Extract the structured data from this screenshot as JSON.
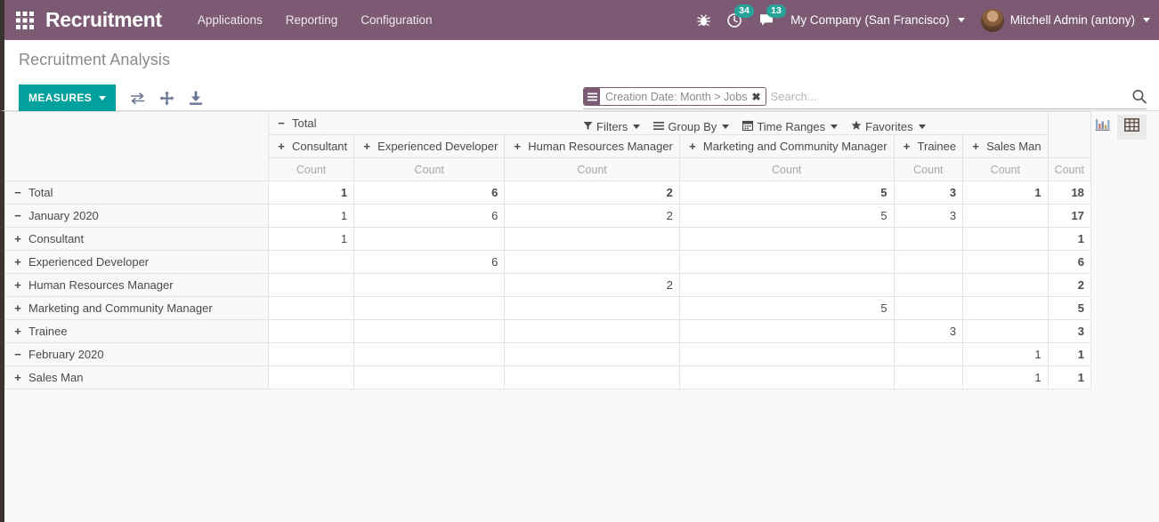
{
  "navbar": {
    "apps_icon": "apps-grid-icon",
    "brand": "Recruitment",
    "menu": [
      {
        "label": "Applications"
      },
      {
        "label": "Reporting"
      },
      {
        "label": "Configuration"
      }
    ],
    "bug_icon": "bug-icon",
    "activity_icon": "clock-activity-icon",
    "activity_count": "34",
    "messages_icon": "chat-messages-icon",
    "messages_count": "13",
    "company": "My Company (San Francisco)",
    "user": "Mitchell Admin (antony)",
    "brand_color": "#7c5a73",
    "badge_color": "#27a39a"
  },
  "control_panel": {
    "title": "Recruitment Analysis",
    "measures_label": "MEASURES",
    "measures_color": "#00a09d",
    "tools": [
      {
        "name": "flip-axis-icon"
      },
      {
        "name": "expand-all-icon"
      },
      {
        "name": "download-xlsx-icon"
      }
    ],
    "search": {
      "facet_label": "Creation Date: Month > Jobs",
      "facet_remove": "✖",
      "placeholder": "Search...",
      "value": ""
    },
    "filters": [
      {
        "label": "Filters",
        "icon": "filter-icon"
      },
      {
        "label": "Group By",
        "icon": "group-by-icon"
      },
      {
        "label": "Time Ranges",
        "icon": "calendar-icon"
      },
      {
        "label": "Favorites",
        "icon": "star-icon"
      }
    ],
    "views": [
      {
        "name": "graph-view",
        "icon": "bar-chart-icon",
        "active": false
      },
      {
        "name": "pivot-view",
        "icon": "pivot-table-icon",
        "active": true
      }
    ]
  },
  "pivot": {
    "col_root": {
      "label": "Total",
      "toggle": "−"
    },
    "columns": [
      {
        "label": "Consultant",
        "toggle": "+"
      },
      {
        "label": "Experienced Developer",
        "toggle": "+"
      },
      {
        "label": "Human Resources Manager",
        "toggle": "+"
      },
      {
        "label": "Marketing and Community Manager",
        "toggle": "+"
      },
      {
        "label": "Trainee",
        "toggle": "+"
      },
      {
        "label": "Sales Man",
        "toggle": "+"
      }
    ],
    "measure_label": "Count",
    "total_measure_label": "Count",
    "rows": [
      {
        "label": "Total",
        "toggle": "−",
        "indent": 0,
        "bold": true,
        "values": [
          "1",
          "6",
          "2",
          "5",
          "3",
          "1"
        ],
        "total": "18"
      },
      {
        "label": "January 2020",
        "toggle": "−",
        "indent": 1,
        "bold": false,
        "values": [
          "1",
          "6",
          "2",
          "5",
          "3",
          ""
        ],
        "total": "17"
      },
      {
        "label": "Consultant",
        "toggle": "+",
        "indent": 2,
        "bold": false,
        "values": [
          "1",
          "",
          "",
          "",
          "",
          ""
        ],
        "total": "1"
      },
      {
        "label": "Experienced Developer",
        "toggle": "+",
        "indent": 2,
        "bold": false,
        "values": [
          "",
          "6",
          "",
          "",
          "",
          ""
        ],
        "total": "6"
      },
      {
        "label": "Human Resources Manager",
        "toggle": "+",
        "indent": 2,
        "bold": false,
        "values": [
          "",
          "",
          "2",
          "",
          "",
          ""
        ],
        "total": "2"
      },
      {
        "label": "Marketing and Community Manager",
        "toggle": "+",
        "indent": 2,
        "bold": false,
        "values": [
          "",
          "",
          "",
          "5",
          "",
          ""
        ],
        "total": "5"
      },
      {
        "label": "Trainee",
        "toggle": "+",
        "indent": 2,
        "bold": false,
        "values": [
          "",
          "",
          "",
          "",
          "3",
          ""
        ],
        "total": "3"
      },
      {
        "label": "February 2020",
        "toggle": "−",
        "indent": 1,
        "bold": false,
        "values": [
          "",
          "",
          "",
          "",
          "",
          "1"
        ],
        "total": "1"
      },
      {
        "label": "Sales Man",
        "toggle": "+",
        "indent": 2,
        "bold": false,
        "values": [
          "",
          "",
          "",
          "",
          "",
          "1"
        ],
        "total": "1"
      }
    ]
  }
}
